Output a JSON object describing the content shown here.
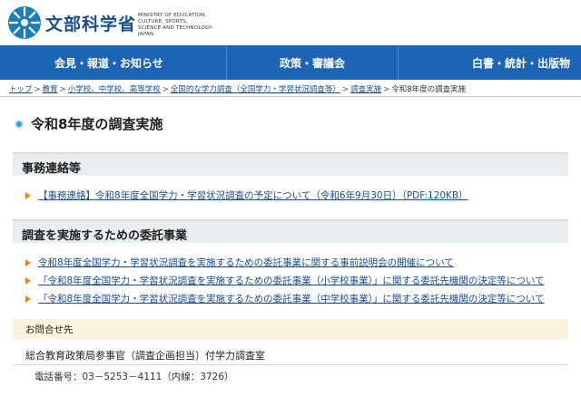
{
  "header": {
    "logo_ja": "文部科学省",
    "logo_en_1": "MINISTRY OF EDUCATION,",
    "logo_en_2": "CULTURE, SPORTS,",
    "logo_en_3": "SCIENCE AND TECHNOLOGY-JAPAN"
  },
  "nav": {
    "items": [
      "会見・報道・お知らせ",
      "政策・審議会",
      "白書・統計・出版物"
    ]
  },
  "breadcrumb": {
    "items": [
      "トップ",
      "教育",
      "小学校、中学校、高等学校",
      "全国的な学力調査（全国学力・学習状況調査等）",
      "調査実施"
    ],
    "current": "令和8年度の調査実施",
    "separator": ">"
  },
  "page": {
    "title": "令和8年度の調査実施"
  },
  "sections": [
    {
      "heading": "事務連絡等",
      "links": [
        "【事務連絡】令和8年度全国学力・学習状況調査の予定について（令和6年9月30日）（PDF:120KB）"
      ]
    },
    {
      "heading": "調査を実施するための委託事業",
      "links": [
        "令和8年度全国学力・学習状況調査を実施するための委託事業に関する事前説明会の開催について",
        "「令和8年度全国学力・学習状況調査を実施するための委託事業（小学校事業）」に関する委託先機関の決定等について",
        "「令和8年度全国学力・学習状況調査を実施するための委託事業（中学校事業）」に関する委託先機関の決定等について"
      ]
    }
  ],
  "contact": {
    "heading": "お問合せ先",
    "org": "総合教育政策局参事官（調査企画担当）付学力調査室",
    "tel": "電話番号：03－5253－4111（内線：3726）"
  },
  "colors": {
    "nav_bg": "#1e64b4",
    "link": "#1a4f8b",
    "arrow": "#e0861a",
    "logo": "#1a4f8b"
  }
}
